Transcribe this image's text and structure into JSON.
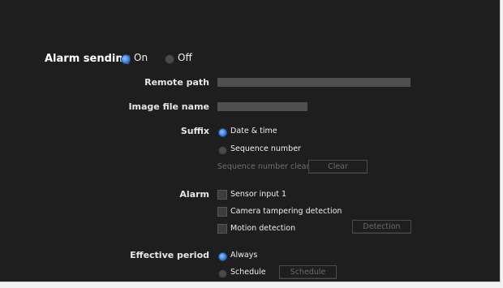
{
  "alarm_sending": {
    "label": "Alarm sending",
    "options": [
      "On",
      "Off"
    ],
    "selected": "On"
  },
  "remote_path": {
    "label": "Remote path",
    "value": ""
  },
  "image_file_name": {
    "label": "Image file name",
    "value": ""
  },
  "suffix": {
    "label": "Suffix",
    "options": [
      "Date & time",
      "Sequence number"
    ],
    "selected": "Date & time",
    "sequence_clear_label": "Sequence number clear",
    "clear_button": "Clear"
  },
  "alarm": {
    "label": "Alarm",
    "checkboxes": [
      "Sensor input 1",
      "Camera tampering detection",
      "Motion detection"
    ],
    "detection_button": "Detection"
  },
  "effective_period": {
    "label": "Effective period",
    "options": [
      "Always",
      "Schedule"
    ],
    "selected": "Always",
    "schedule_button": "Schedule"
  },
  "colors": {
    "background": "#1e1e1e",
    "accent_radio": "#3b7fd9",
    "field": "#4f4f4f"
  }
}
